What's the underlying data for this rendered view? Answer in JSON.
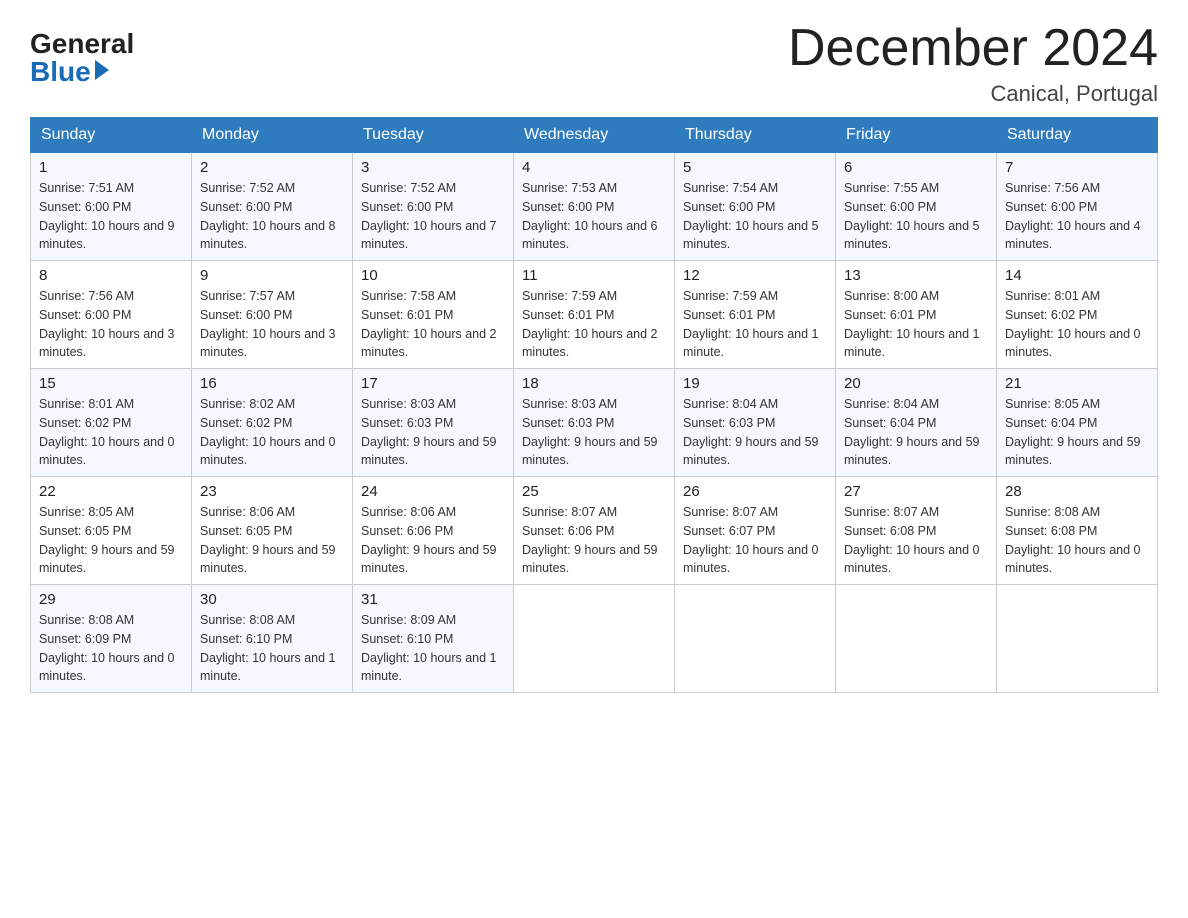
{
  "logo": {
    "general": "General",
    "blue": "Blue"
  },
  "title": "December 2024",
  "location": "Canical, Portugal",
  "days_header": [
    "Sunday",
    "Monday",
    "Tuesday",
    "Wednesday",
    "Thursday",
    "Friday",
    "Saturday"
  ],
  "weeks": [
    [
      {
        "num": "1",
        "sunrise": "7:51 AM",
        "sunset": "6:00 PM",
        "daylight": "10 hours and 9 minutes."
      },
      {
        "num": "2",
        "sunrise": "7:52 AM",
        "sunset": "6:00 PM",
        "daylight": "10 hours and 8 minutes."
      },
      {
        "num": "3",
        "sunrise": "7:52 AM",
        "sunset": "6:00 PM",
        "daylight": "10 hours and 7 minutes."
      },
      {
        "num": "4",
        "sunrise": "7:53 AM",
        "sunset": "6:00 PM",
        "daylight": "10 hours and 6 minutes."
      },
      {
        "num": "5",
        "sunrise": "7:54 AM",
        "sunset": "6:00 PM",
        "daylight": "10 hours and 5 minutes."
      },
      {
        "num": "6",
        "sunrise": "7:55 AM",
        "sunset": "6:00 PM",
        "daylight": "10 hours and 5 minutes."
      },
      {
        "num": "7",
        "sunrise": "7:56 AM",
        "sunset": "6:00 PM",
        "daylight": "10 hours and 4 minutes."
      }
    ],
    [
      {
        "num": "8",
        "sunrise": "7:56 AM",
        "sunset": "6:00 PM",
        "daylight": "10 hours and 3 minutes."
      },
      {
        "num": "9",
        "sunrise": "7:57 AM",
        "sunset": "6:00 PM",
        "daylight": "10 hours and 3 minutes."
      },
      {
        "num": "10",
        "sunrise": "7:58 AM",
        "sunset": "6:01 PM",
        "daylight": "10 hours and 2 minutes."
      },
      {
        "num": "11",
        "sunrise": "7:59 AM",
        "sunset": "6:01 PM",
        "daylight": "10 hours and 2 minutes."
      },
      {
        "num": "12",
        "sunrise": "7:59 AM",
        "sunset": "6:01 PM",
        "daylight": "10 hours and 1 minute."
      },
      {
        "num": "13",
        "sunrise": "8:00 AM",
        "sunset": "6:01 PM",
        "daylight": "10 hours and 1 minute."
      },
      {
        "num": "14",
        "sunrise": "8:01 AM",
        "sunset": "6:02 PM",
        "daylight": "10 hours and 0 minutes."
      }
    ],
    [
      {
        "num": "15",
        "sunrise": "8:01 AM",
        "sunset": "6:02 PM",
        "daylight": "10 hours and 0 minutes."
      },
      {
        "num": "16",
        "sunrise": "8:02 AM",
        "sunset": "6:02 PM",
        "daylight": "10 hours and 0 minutes."
      },
      {
        "num": "17",
        "sunrise": "8:03 AM",
        "sunset": "6:03 PM",
        "daylight": "9 hours and 59 minutes."
      },
      {
        "num": "18",
        "sunrise": "8:03 AM",
        "sunset": "6:03 PM",
        "daylight": "9 hours and 59 minutes."
      },
      {
        "num": "19",
        "sunrise": "8:04 AM",
        "sunset": "6:03 PM",
        "daylight": "9 hours and 59 minutes."
      },
      {
        "num": "20",
        "sunrise": "8:04 AM",
        "sunset": "6:04 PM",
        "daylight": "9 hours and 59 minutes."
      },
      {
        "num": "21",
        "sunrise": "8:05 AM",
        "sunset": "6:04 PM",
        "daylight": "9 hours and 59 minutes."
      }
    ],
    [
      {
        "num": "22",
        "sunrise": "8:05 AM",
        "sunset": "6:05 PM",
        "daylight": "9 hours and 59 minutes."
      },
      {
        "num": "23",
        "sunrise": "8:06 AM",
        "sunset": "6:05 PM",
        "daylight": "9 hours and 59 minutes."
      },
      {
        "num": "24",
        "sunrise": "8:06 AM",
        "sunset": "6:06 PM",
        "daylight": "9 hours and 59 minutes."
      },
      {
        "num": "25",
        "sunrise": "8:07 AM",
        "sunset": "6:06 PM",
        "daylight": "9 hours and 59 minutes."
      },
      {
        "num": "26",
        "sunrise": "8:07 AM",
        "sunset": "6:07 PM",
        "daylight": "10 hours and 0 minutes."
      },
      {
        "num": "27",
        "sunrise": "8:07 AM",
        "sunset": "6:08 PM",
        "daylight": "10 hours and 0 minutes."
      },
      {
        "num": "28",
        "sunrise": "8:08 AM",
        "sunset": "6:08 PM",
        "daylight": "10 hours and 0 minutes."
      }
    ],
    [
      {
        "num": "29",
        "sunrise": "8:08 AM",
        "sunset": "6:09 PM",
        "daylight": "10 hours and 0 minutes."
      },
      {
        "num": "30",
        "sunrise": "8:08 AM",
        "sunset": "6:10 PM",
        "daylight": "10 hours and 1 minute."
      },
      {
        "num": "31",
        "sunrise": "8:09 AM",
        "sunset": "6:10 PM",
        "daylight": "10 hours and 1 minute."
      },
      null,
      null,
      null,
      null
    ]
  ],
  "labels": {
    "sunrise": "Sunrise:",
    "sunset": "Sunset:",
    "daylight": "Daylight:"
  }
}
